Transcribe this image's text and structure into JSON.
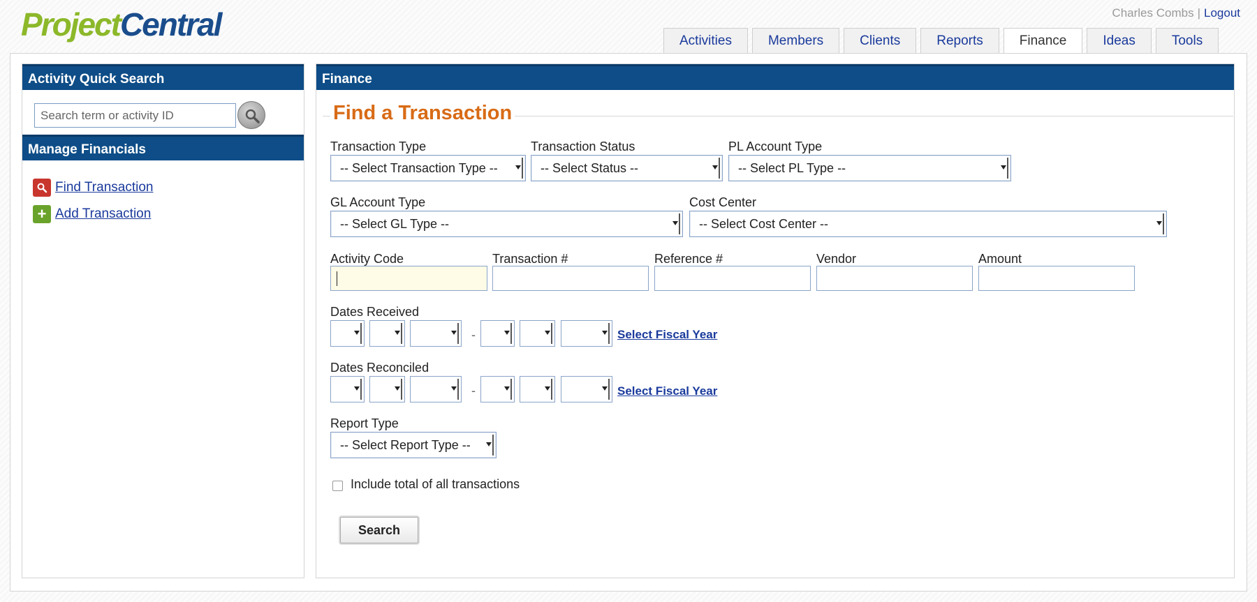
{
  "app": {
    "logo_part1": "Project",
    "logo_part2": "Central"
  },
  "user": {
    "name": "Charles Combs",
    "separator": "|",
    "logout_label": "Logout"
  },
  "tabs": [
    {
      "label": "Activities"
    },
    {
      "label": "Members"
    },
    {
      "label": "Clients"
    },
    {
      "label": "Reports"
    },
    {
      "label": "Finance"
    },
    {
      "label": "Ideas"
    },
    {
      "label": "Tools"
    }
  ],
  "active_tab": "Finance",
  "sidebar": {
    "quick_search_title": "Activity Quick Search",
    "search_placeholder": "Search term or activity ID",
    "manage_title": "Manage Financials",
    "items": [
      {
        "label": "Find Transaction",
        "icon": "magnifier-icon"
      },
      {
        "label": "Add Transaction",
        "icon": "plus-icon"
      }
    ]
  },
  "main": {
    "panel_title": "Finance",
    "form_title": "Find a Transaction",
    "fields": {
      "transaction_type_label": "Transaction Type",
      "transaction_type_value": "-- Select Transaction Type --",
      "transaction_status_label": "Transaction Status",
      "transaction_status_value": "-- Select Status --",
      "pl_account_label": "PL Account Type",
      "pl_account_value": "-- Select PL Type --",
      "gl_account_label": "GL Account Type",
      "gl_account_value": "-- Select GL Type --",
      "cost_center_label": "Cost Center",
      "cost_center_value": "-- Select Cost Center --",
      "activity_code_label": "Activity Code",
      "transaction_num_label": "Transaction #",
      "reference_num_label": "Reference #",
      "vendor_label": "Vendor",
      "amount_label": "Amount",
      "dates_received_label": "Dates Received",
      "dates_reconciled_label": "Dates Reconciled",
      "date_range_separator": "-",
      "select_fiscal_year": "Select Fiscal Year",
      "report_type_label": "Report Type",
      "report_type_value": "-- Select Report Type --",
      "include_total_label": "Include total of all transactions"
    },
    "search_button": "Search"
  },
  "colors": {
    "header_blue": "#0e4d87",
    "title_orange": "#d86b16",
    "link_blue": "#1a3a9c",
    "logo_green": "#8cb82a",
    "logo_blue": "#1a4d8c"
  }
}
